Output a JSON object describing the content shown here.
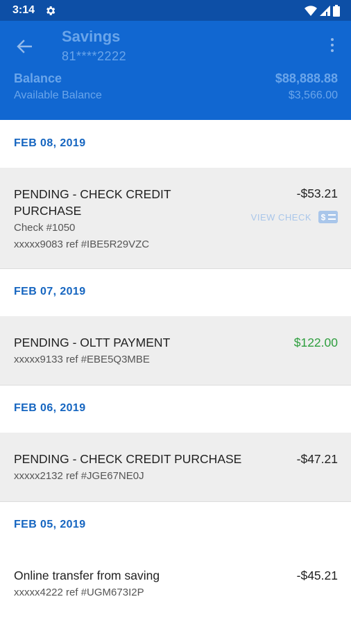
{
  "status_bar": {
    "time": "3:14"
  },
  "header": {
    "title": "Savings",
    "account_number": "81****2222",
    "balance_label": "Balance",
    "balance_value": "$88,888.88",
    "available_label": "Available Balance",
    "available_value": "$3,566.00"
  },
  "groups": [
    {
      "date": "FEB 08, 2019",
      "transactions": [
        {
          "description": "PENDING - CHECK CREDIT PURCHASE",
          "line2": "Check #1050",
          "line3": "xxxxx9083 ref #IBE5R29VZC",
          "amount": "-$53.21",
          "view_check_label": "VIEW CHECK"
        }
      ]
    },
    {
      "date": "FEB 07, 2019",
      "transactions": [
        {
          "description": "PENDING - OLTT PAYMENT",
          "line2": "xxxxx9133 ref #EBE5Q3MBE",
          "amount": "$122.00"
        }
      ]
    },
    {
      "date": "FEB 06, 2019",
      "transactions": [
        {
          "description": "PENDING - CHECK CREDIT PURCHASE",
          "line2": "xxxxx2132 ref #JGE67NE0J",
          "amount": "-$47.21"
        }
      ]
    },
    {
      "date": "FEB 05, 2019",
      "transactions": [
        {
          "description": "Online transfer from saving",
          "line2": "xxxxx4222 ref #UGM673I2P",
          "amount": "-$45.21"
        }
      ]
    }
  ],
  "colors": {
    "status_bar": "#0d4fa6",
    "app_bar": "#1167d1",
    "date_text": "#1565c0",
    "credit_amount": "#2e9e3e",
    "row_background": "#eeeeee"
  }
}
